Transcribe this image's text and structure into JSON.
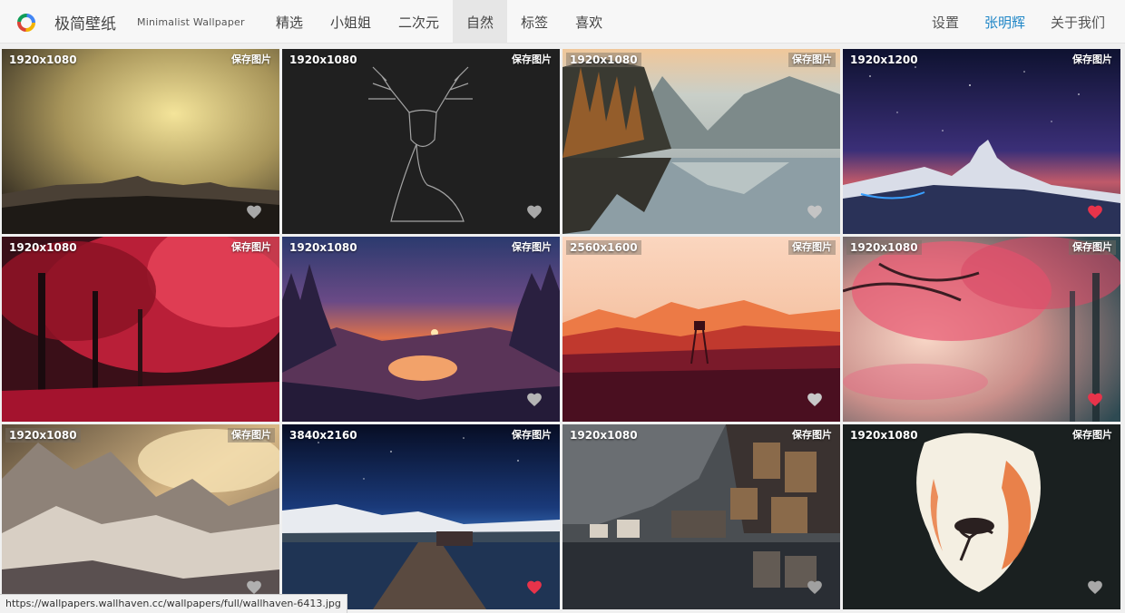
{
  "header": {
    "brand": "极简壁纸",
    "subtitle": "Minimalist Wallpaper",
    "nav": [
      "精选",
      "小姐姐",
      "二次元",
      "自然",
      "标签",
      "喜欢"
    ],
    "active_nav": "自然",
    "right_nav": {
      "settings": "设置",
      "user": "张明辉",
      "about": "关于我们"
    }
  },
  "cards": [
    {
      "resolution": "1920x1080",
      "save": "保存图片",
      "liked": false,
      "scene": "dusk-mountains"
    },
    {
      "resolution": "1920x1080",
      "save": "保存图片",
      "liked": false,
      "scene": "deer-line-art"
    },
    {
      "resolution": "1920x1080",
      "save": "保存图片",
      "liked": false,
      "scene": "lake-reflection"
    },
    {
      "resolution": "1920x1200",
      "save": "保存图片",
      "liked": true,
      "scene": "starry-matterhorn"
    },
    {
      "resolution": "1920x1080",
      "save": "保存图片",
      "liked": false,
      "scene": "red-forest"
    },
    {
      "resolution": "1920x1080",
      "save": "保存图片",
      "liked": false,
      "scene": "sunset-deer-lake"
    },
    {
      "resolution": "2560x1600",
      "save": "保存图片",
      "liked": false,
      "scene": "firewatch-tower"
    },
    {
      "resolution": "1920x1080",
      "save": "保存图片",
      "liked": true,
      "scene": "pink-blossom-tree"
    },
    {
      "resolution": "1920x1080",
      "save": "保存图片",
      "liked": false,
      "scene": "golden-snow-mountains"
    },
    {
      "resolution": "3840x2160",
      "save": "保存图片",
      "liked": true,
      "scene": "pier-night-sky"
    },
    {
      "resolution": "1920x1080",
      "save": "保存图片",
      "liked": false,
      "scene": "hallstatt-village"
    },
    {
      "resolution": "1920x1080",
      "save": "保存图片",
      "liked": false,
      "scene": "cave-tree-silhouette"
    }
  ],
  "status_url": "https://wallpapers.wallhaven.cc/wallpapers/full/wallhaven-6413.jpg",
  "colors": {
    "heart_liked": "#e8334a",
    "heart_unliked": "#9a9a9a",
    "user_link": "#1f86c7"
  }
}
